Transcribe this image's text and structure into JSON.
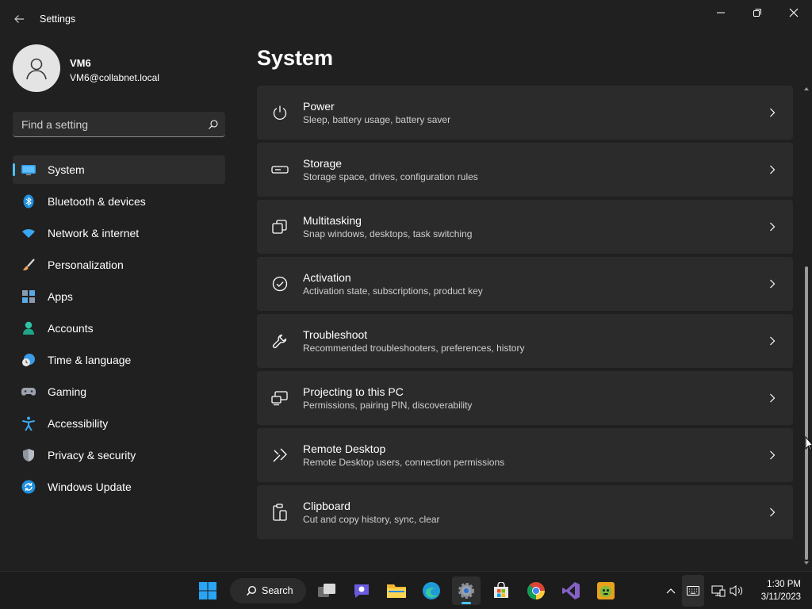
{
  "app": {
    "title": "Settings"
  },
  "profile": {
    "name": "VM6",
    "email": "VM6@collabnet.local"
  },
  "search": {
    "placeholder": "Find a setting"
  },
  "sidebar": {
    "items": [
      {
        "label": "System",
        "icon": "system-icon",
        "selected": true
      },
      {
        "label": "Bluetooth & devices",
        "icon": "bluetooth-icon"
      },
      {
        "label": "Network & internet",
        "icon": "wifi-icon"
      },
      {
        "label": "Personalization",
        "icon": "brush-icon"
      },
      {
        "label": "Apps",
        "icon": "apps-icon"
      },
      {
        "label": "Accounts",
        "icon": "person-icon"
      },
      {
        "label": "Time & language",
        "icon": "clock-globe-icon"
      },
      {
        "label": "Gaming",
        "icon": "gamepad-icon"
      },
      {
        "label": "Accessibility",
        "icon": "accessibility-icon"
      },
      {
        "label": "Privacy & security",
        "icon": "shield-icon"
      },
      {
        "label": "Windows Update",
        "icon": "update-icon"
      }
    ]
  },
  "main": {
    "title": "System",
    "cards": [
      {
        "title": "Power",
        "subtitle": "Sleep, battery usage, battery saver",
        "icon": "power-icon"
      },
      {
        "title": "Storage",
        "subtitle": "Storage space, drives, configuration rules",
        "icon": "storage-icon"
      },
      {
        "title": "Multitasking",
        "subtitle": "Snap windows, desktops, task switching",
        "icon": "multitasking-icon"
      },
      {
        "title": "Activation",
        "subtitle": "Activation state, subscriptions, product key",
        "icon": "check-circle-icon"
      },
      {
        "title": "Troubleshoot",
        "subtitle": "Recommended troubleshooters, preferences, history",
        "icon": "wrench-icon"
      },
      {
        "title": "Projecting to this PC",
        "subtitle": "Permissions, pairing PIN, discoverability",
        "icon": "projector-icon"
      },
      {
        "title": "Remote Desktop",
        "subtitle": "Remote Desktop users, connection permissions",
        "icon": "remote-desktop-icon"
      },
      {
        "title": "Clipboard",
        "subtitle": "Cut and copy history, sync, clear",
        "icon": "clipboard-icon"
      }
    ]
  },
  "taskbar": {
    "search_label": "Search",
    "time": "1:30 PM",
    "date": "3/11/2023"
  },
  "colors": {
    "accent": "#4cc2ff",
    "background": "#202020",
    "card": "#2b2b2b"
  }
}
